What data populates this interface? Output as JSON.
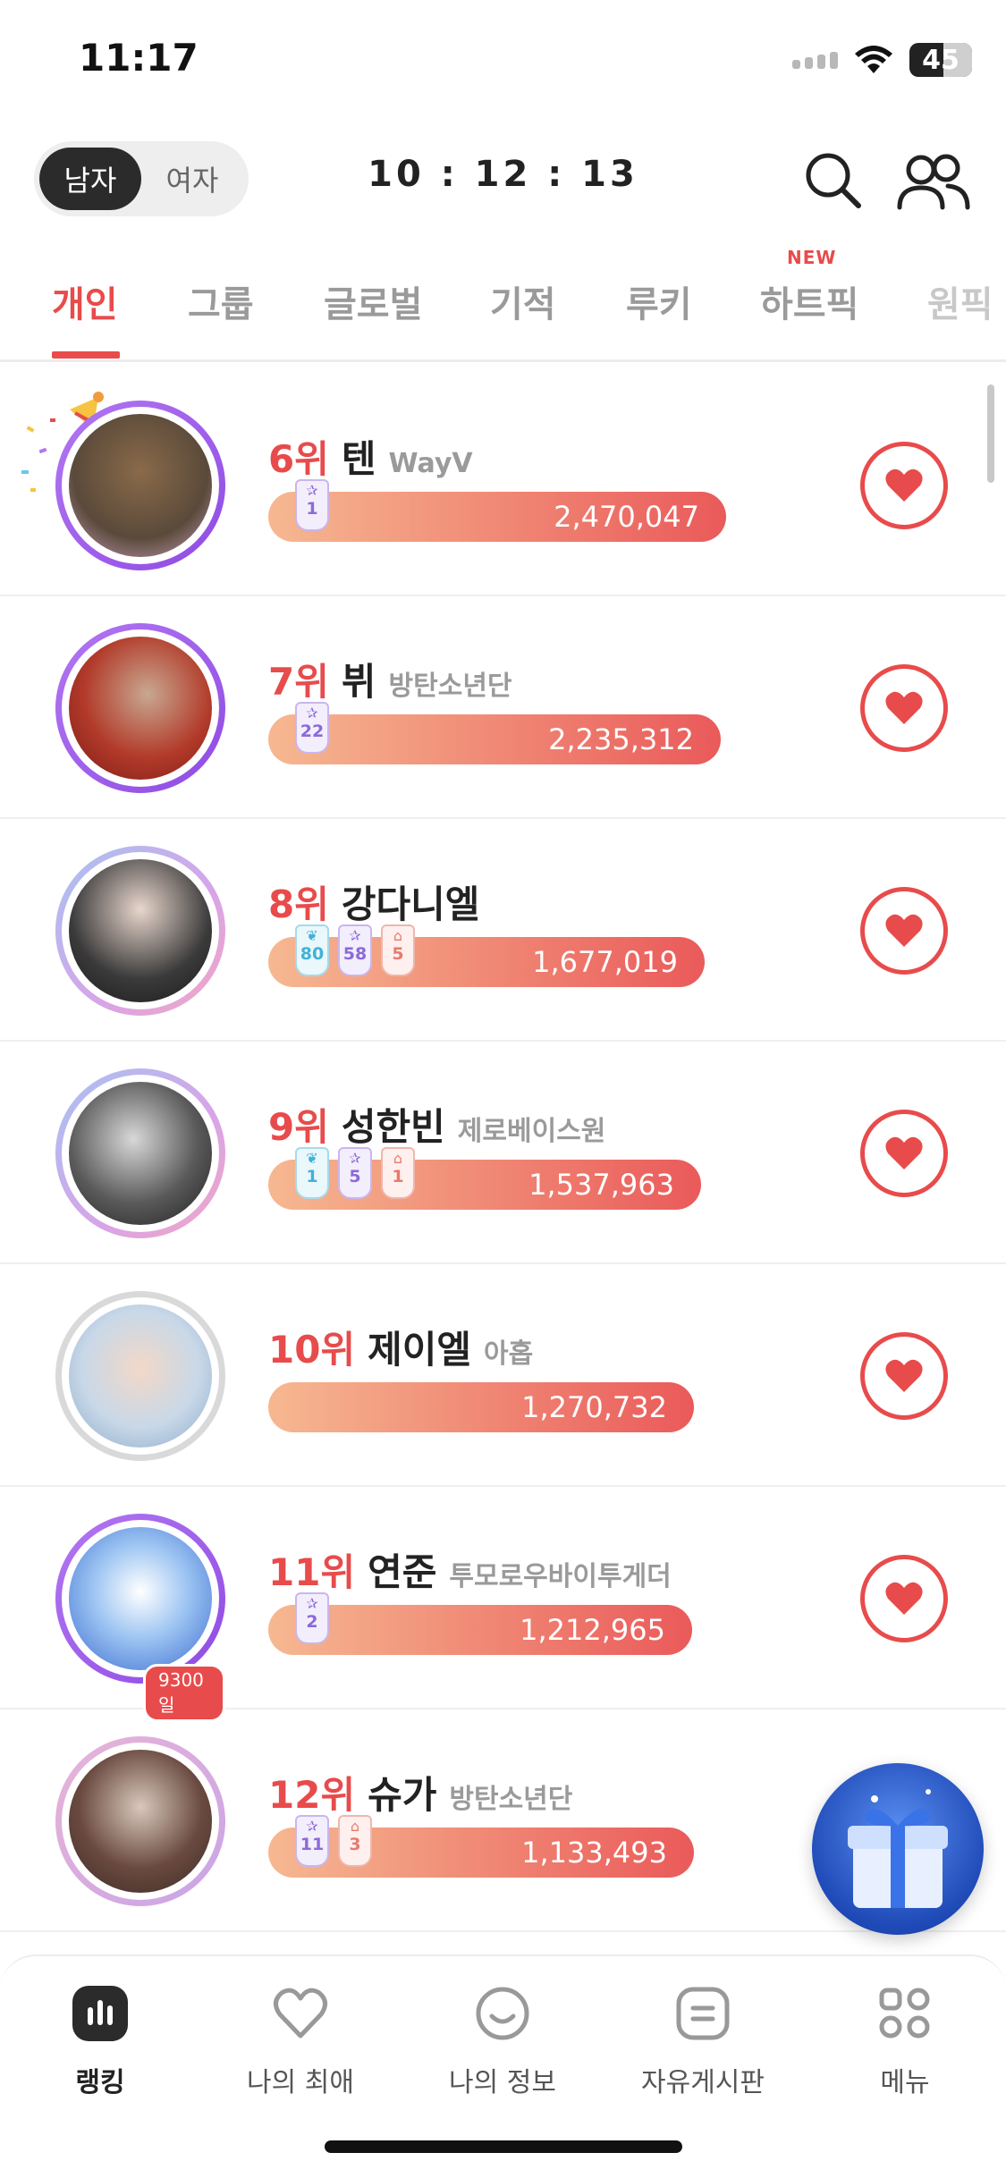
{
  "status_bar": {
    "time": "11:17",
    "battery": "45"
  },
  "header": {
    "gender_options": [
      "남자",
      "여자"
    ],
    "timer": "10 : 12 : 13"
  },
  "tabs": [
    {
      "label": "개인",
      "active": true
    },
    {
      "label": "그룹"
    },
    {
      "label": "글로벌"
    },
    {
      "label": "기적"
    },
    {
      "label": "루키"
    },
    {
      "label": "하트픽",
      "badge": "NEW"
    },
    {
      "label": "원픽"
    }
  ],
  "ranking": [
    {
      "rank": "6위",
      "name": "텐",
      "group": "WayV",
      "votes": "2,470,047",
      "badges": [
        {
          "type": "star",
          "count": "1"
        }
      ]
    },
    {
      "rank": "7위",
      "name": "뷔",
      "group": "방탄소년단",
      "votes": "2,235,312",
      "badges": [
        {
          "type": "star",
          "count": "22"
        }
      ]
    },
    {
      "rank": "8위",
      "name": "강다니엘",
      "group": "",
      "votes": "1,677,019",
      "badges": [
        {
          "type": "leaf",
          "count": "80"
        },
        {
          "type": "star",
          "count": "58"
        },
        {
          "type": "cake",
          "count": "5"
        }
      ]
    },
    {
      "rank": "9위",
      "name": "성한빈",
      "group": "제로베이스원",
      "votes": "1,537,963",
      "badges": [
        {
          "type": "leaf",
          "count": "1"
        },
        {
          "type": "star",
          "count": "5"
        },
        {
          "type": "cake",
          "count": "1"
        }
      ]
    },
    {
      "rank": "10위",
      "name": "제이엘",
      "group": "아홉",
      "votes": "1,270,732",
      "badges": []
    },
    {
      "rank": "11위",
      "name": "연준",
      "group": "투모로우바이투게더",
      "votes": "1,212,965",
      "badges": [
        {
          "type": "star",
          "count": "2"
        }
      ],
      "day_badge": "9300일"
    },
    {
      "rank": "12위",
      "name": "슈가",
      "group": "방탄소년단",
      "votes": "1,133,493",
      "badges": [
        {
          "type": "star",
          "count": "11"
        },
        {
          "type": "cake",
          "count": "3"
        }
      ]
    }
  ],
  "bottom_nav": [
    {
      "label": "랭킹",
      "icon": "bar-chart-icon",
      "active": true
    },
    {
      "label": "나의 최애",
      "icon": "heart-outline-icon"
    },
    {
      "label": "나의 정보",
      "icon": "smile-icon"
    },
    {
      "label": "자유게시판",
      "icon": "board-icon"
    },
    {
      "label": "메뉴",
      "icon": "menu-grid-icon"
    }
  ],
  "colors": {
    "accent": "#e84b4b",
    "bar_start": "#f6b891",
    "bar_end": "#ea5a5a"
  }
}
